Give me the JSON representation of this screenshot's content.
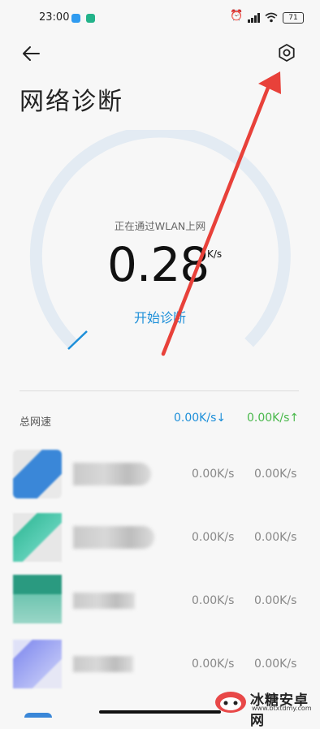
{
  "status_bar": {
    "time": "23:00",
    "battery": "71"
  },
  "header": {
    "title": "网络诊断"
  },
  "gauge": {
    "caption": "正在通过WLAN上网",
    "speed_value": "0.28",
    "speed_unit": "K/s",
    "start_button": "开始诊断"
  },
  "total": {
    "label": "总网速",
    "down": "0.00K/s",
    "up": "0.00K/s",
    "down_arrow": "↓",
    "up_arrow": "↑"
  },
  "apps": [
    {
      "down": "0.00K/s",
      "up": "0.00K/s",
      "icon_color": "#3a87d8"
    },
    {
      "down": "0.00K/s",
      "up": "0.00K/s",
      "icon_color": "#3fbfa0"
    },
    {
      "down": "0.00K/s",
      "up": "0.00K/s",
      "icon_color": "#2a9a80"
    },
    {
      "down": "0.00K/s",
      "up": "0.00K/s",
      "icon_color": "#8c95f0"
    }
  ],
  "watermark": {
    "text": "冰糖安卓网",
    "url": "www.btxtdmy.com"
  },
  "colors": {
    "accent_blue": "#1d8fd9",
    "upload_green": "#49b84b",
    "annotation_red": "#e8413a",
    "gauge_track": "#e3ebf3"
  }
}
